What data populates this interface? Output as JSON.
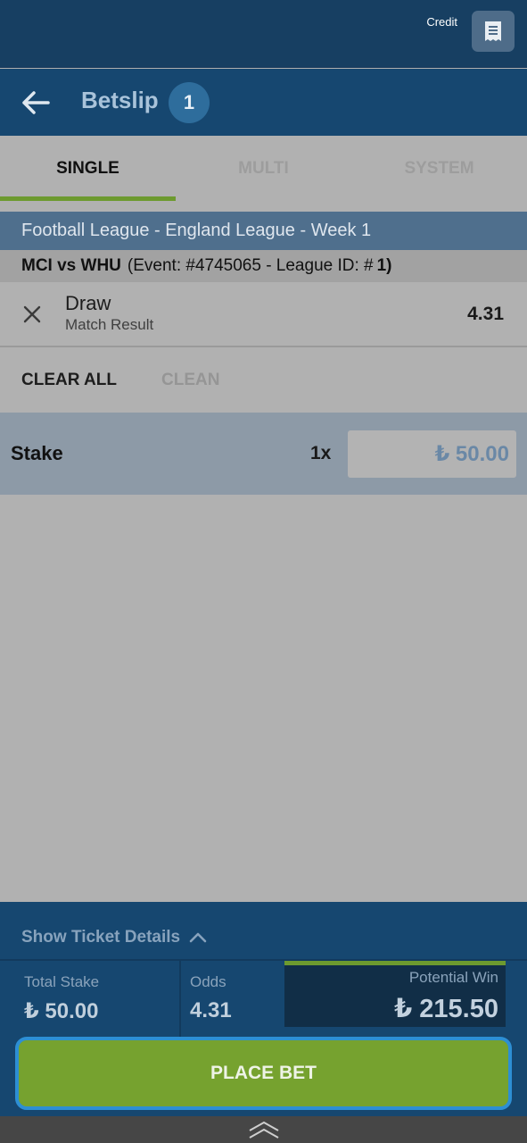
{
  "topbar": {
    "credit_label": "Credit",
    "receipt_icon": "receipt-icon"
  },
  "header": {
    "back_icon": "arrow-left-icon",
    "title": "Betslip",
    "count": "1"
  },
  "tabs": [
    {
      "label": "SINGLE",
      "active": true
    },
    {
      "label": "MULTI",
      "active": false
    },
    {
      "label": "SYSTEM",
      "active": false
    }
  ],
  "bet": {
    "league": "Football League - England League - Week 1",
    "teams": "MCI vs WHU",
    "event_info": "(Event: #4745065 - League ID: #",
    "league_id": "1)",
    "pick": "Draw",
    "market": "Match Result",
    "odds": "4.31",
    "remove_icon": "close-icon"
  },
  "actions": {
    "clear_all": "CLEAR ALL",
    "clean": "CLEAN"
  },
  "stake": {
    "label": "Stake",
    "multiplier": "1x",
    "value": "₺ 50.00"
  },
  "footer": {
    "toggle_label": "Show Ticket Details",
    "toggle_icon": "chevron-up-icon",
    "total_stake_label": "Total Stake",
    "total_stake_value": "₺ 50.00",
    "odds_label": "Odds",
    "odds_value": "4.31",
    "potential_win_label": "Potential Win",
    "potential_win_value": "₺ 215.50"
  },
  "place_bet_label": "PLACE BET",
  "colors": {
    "header_bg": "#164770",
    "accent_green": "#76a22f",
    "button_border": "#2d8fd4",
    "overlay_gray": "#b1b1b1"
  }
}
